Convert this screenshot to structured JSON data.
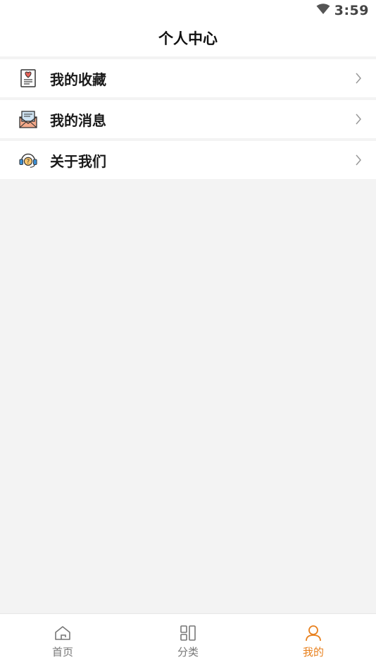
{
  "status_bar": {
    "time": "3:59",
    "wifi_icon": "wifi-icon"
  },
  "header": {
    "title": "个人中心"
  },
  "menu": [
    {
      "label": "我的收藏",
      "icon": "favorites-icon"
    },
    {
      "label": "我的消息",
      "icon": "message-envelope-icon"
    },
    {
      "label": "关于我们",
      "icon": "customer-service-icon"
    }
  ],
  "tabbar": {
    "tabs": [
      {
        "label": "首页",
        "icon": "home-icon",
        "active": false
      },
      {
        "label": "分类",
        "icon": "category-icon",
        "active": false
      },
      {
        "label": "我的",
        "icon": "user-icon",
        "active": true
      }
    ]
  },
  "colors": {
    "accent": "#e8801d",
    "page_bg": "#f3f3f3",
    "text": "#1a1a1a"
  }
}
